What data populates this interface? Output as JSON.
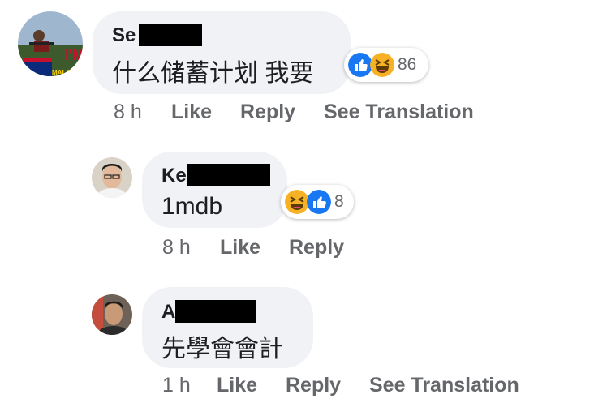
{
  "comments": [
    {
      "author_visible": "Se",
      "text": "什么储蓄计划 我要",
      "time": "8 h",
      "actions": [
        "Like",
        "Reply",
        "See Translation"
      ],
      "reactions": {
        "icons": [
          "like-icon",
          "haha-icon"
        ],
        "count": "86"
      },
      "avatar_text": "MALAYSIA"
    },
    {
      "author_visible": "Ke",
      "text": "1mdb",
      "time": "8 h",
      "actions": [
        "Like",
        "Reply"
      ],
      "reactions": {
        "icons": [
          "haha-icon",
          "like-icon"
        ],
        "count": "8"
      }
    },
    {
      "author_visible": "A",
      "text": "先學會會計",
      "time": "1 h",
      "actions": [
        "Like",
        "Reply",
        "See Translation"
      ]
    }
  ],
  "colors": {
    "bubble": "#f0f2f5",
    "meta": "#65676b",
    "like": "#1877f2",
    "haha": "#f7b125"
  }
}
